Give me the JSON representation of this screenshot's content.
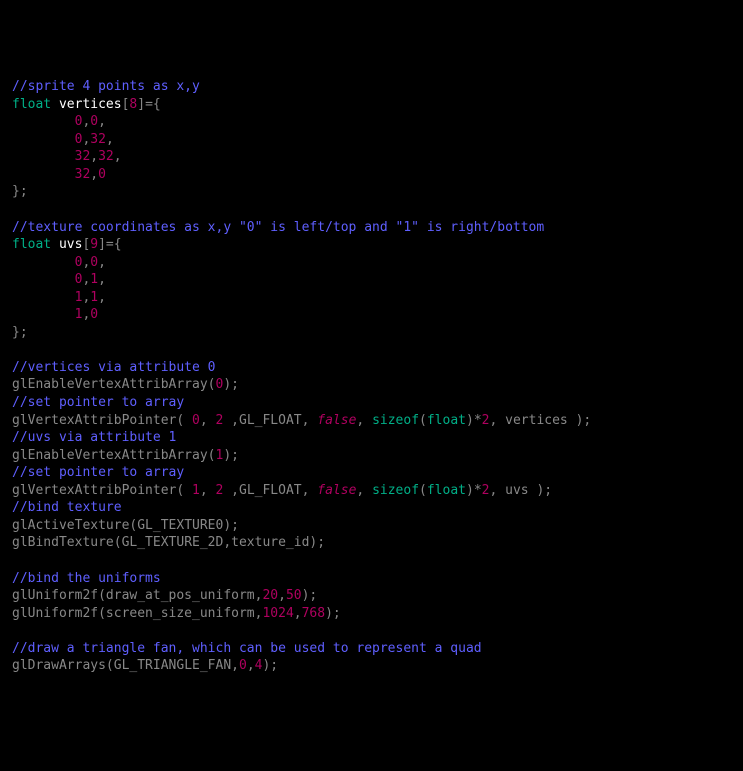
{
  "code": {
    "l1": "//sprite 4 points as x,y",
    "l2a": "float",
    "l2b": "vertices",
    "l2c": "[",
    "l2d": "8",
    "l2e": "]={",
    "l3a": "0",
    "l3b": ",",
    "l3c": "0",
    "l3d": ",",
    "l4a": "0",
    "l4b": ",",
    "l4c": "32",
    "l4d": ",",
    "l5a": "32",
    "l5b": ",",
    "l5c": "32",
    "l5d": ",",
    "l6a": "32",
    "l6b": ",",
    "l6c": "0",
    "l7": "};",
    "l8": "",
    "l9": "//texture coordinates as x,y \"0\" is left/top and \"1\" is right/bottom",
    "l10a": "float",
    "l10b": "uvs",
    "l10c": "[",
    "l10d": "9",
    "l10e": "]={",
    "l11a": "0",
    "l11b": ",",
    "l11c": "0",
    "l11d": ",",
    "l12a": "0",
    "l12b": ",",
    "l12c": "1",
    "l12d": ",",
    "l13a": "1",
    "l13b": ",",
    "l13c": "1",
    "l13d": ",",
    "l14a": "1",
    "l14b": ",",
    "l14c": "0",
    "l15": "};",
    "l16": "",
    "l17": "//vertices via attribute 0",
    "l18a": "glEnableVertexAttribArray",
    "l18b": "(",
    "l18c": "0",
    "l18d": ");",
    "l19": "//set pointer to array",
    "l20a": "glVertexAttribPointer",
    "l20b": "( ",
    "l20c": "0",
    "l20d": ", ",
    "l20e": "2",
    "l20f": " ,GL_FLOAT, ",
    "l20g": "false",
    "l20h": ", ",
    "l20i": "sizeof",
    "l20j": "(",
    "l20k": "float",
    "l20l": ")*",
    "l20m": "2",
    "l20n": ", vertices );",
    "l21": "//uvs via attribute 1",
    "l22a": "glEnableVertexAttribArray",
    "l22b": "(",
    "l22c": "1",
    "l22d": ");",
    "l23": "//set pointer to array",
    "l24a": "glVertexAttribPointer",
    "l24b": "( ",
    "l24c": "1",
    "l24d": ", ",
    "l24e": "2",
    "l24f": " ,GL_FLOAT, ",
    "l24g": "false",
    "l24h": ", ",
    "l24i": "sizeof",
    "l24j": "(",
    "l24k": "float",
    "l24l": ")*",
    "l24m": "2",
    "l24n": ", uvs );",
    "l25": "//bind texture",
    "l26a": "glActiveTexture",
    "l26b": "(GL_TEXTURE0);",
    "l27a": "glBindTexture",
    "l27b": "(GL_TEXTURE_2D,texture_id);",
    "l28": "",
    "l29": "//bind the uniforms",
    "l30a": "glUniform2f",
    "l30b": "(draw_at_pos_uniform,",
    "l30c": "20",
    "l30d": ",",
    "l30e": "50",
    "l30f": ");",
    "l31a": "glUniform2f",
    "l31b": "(screen_size_uniform,",
    "l31c": "1024",
    "l31d": ",",
    "l31e": "768",
    "l31f": ");",
    "l32": "",
    "l33": "//draw a triangle fan, which can be used to represent a quad",
    "l34a": "glDrawArrays",
    "l34b": "(GL_TRIANGLE_FAN,",
    "l34c": "0",
    "l34d": ",",
    "l34e": "4",
    "l34f": ");"
  }
}
